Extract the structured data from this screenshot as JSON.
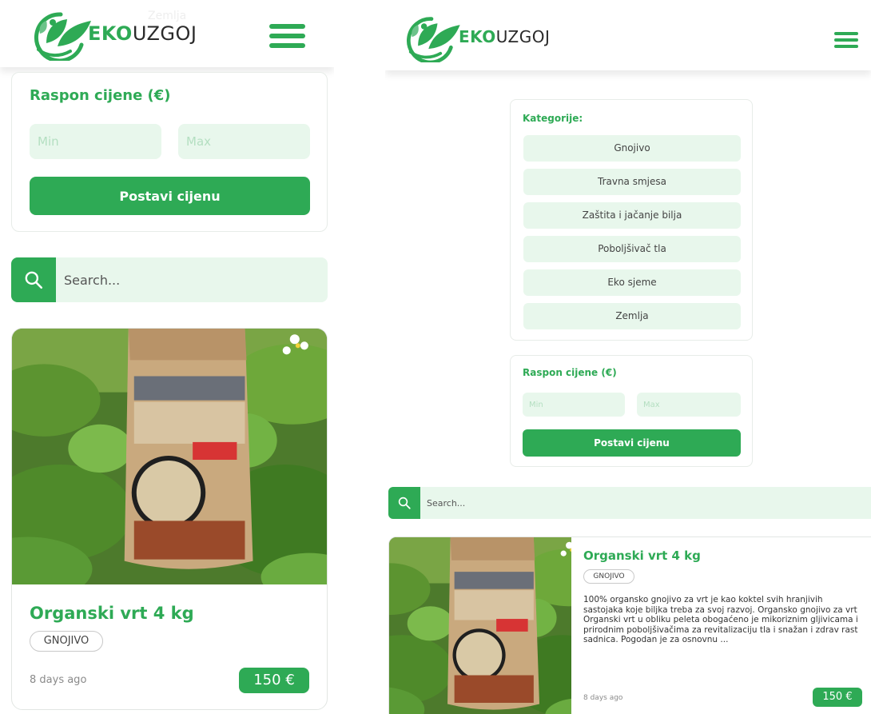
{
  "brand": {
    "eko": "EKO",
    "uzgoj": "UZGOJ"
  },
  "ghost_text": "Zemlja",
  "price_filter": {
    "title": "Raspon cijene (€)",
    "min_placeholder": "Min",
    "max_placeholder": "Max",
    "button": "Postavi cijenu"
  },
  "categories": {
    "title": "Kategorije:",
    "items": [
      "Gnojivo",
      "Travna smjesa",
      "Zaštita i jačanje bilja",
      "Poboljšivač tla",
      "Eko sjeme",
      "Zemlja"
    ]
  },
  "search": {
    "placeholder": "Search..."
  },
  "product": {
    "title": "Organski vrt 4 kg",
    "tag": "GNOJIVO",
    "date": "8 days ago",
    "price": "150 €",
    "description": "100% organsko gnojivo za vrt je kao koktel svih hranjivih sastojaka koje biljka treba za svoj razvoj. Organsko gnojivo za vrt Organski vrt u obliku peleta obogaćeno je mikoriznim gljivicama i prirodnim poboljšivačima za revitalizaciju tla i snažan i zdrav rast sadnica. Pogodan je za osnovnu ..."
  },
  "colors": {
    "accent": "#2eaa55",
    "light": "#e8f7ec"
  }
}
